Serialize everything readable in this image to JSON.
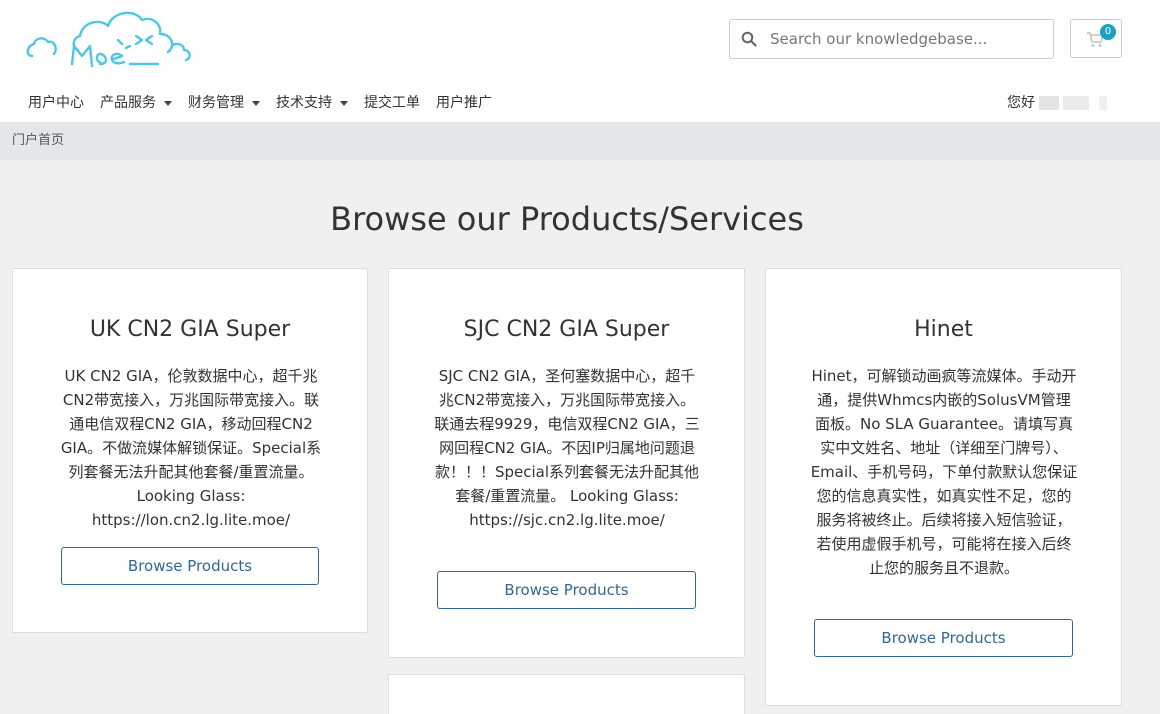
{
  "search": {
    "placeholder": "Search our knowledgebase..."
  },
  "cart": {
    "count": "0"
  },
  "nav": {
    "items": [
      {
        "label": "用户中心",
        "dropdown": false
      },
      {
        "label": "产品服务",
        "dropdown": true
      },
      {
        "label": "财务管理",
        "dropdown": true
      },
      {
        "label": "技术支持",
        "dropdown": true
      },
      {
        "label": "提交工单",
        "dropdown": false
      },
      {
        "label": "用户推广",
        "dropdown": false
      }
    ],
    "greeting": "您好"
  },
  "breadcrumb": {
    "home": "门户首页"
  },
  "main": {
    "title": "Browse our Products/Services",
    "cards": [
      {
        "title": "UK CN2 GIA Super",
        "description": "UK CN2 GIA，伦敦数据中心，超千兆CN2带宽接入，万兆国际带宽接入。联通电信双程CN2 GIA，移动回程CN2 GIA。不做流媒体解锁保证。Special系列套餐无法升配其他套餐/重置流量。 Looking Glass: https://lon.cn2.lg.lite.moe/",
        "button": "Browse Products"
      },
      {
        "title": "SJC CN2 GIA Super",
        "description": "SJC CN2 GIA，圣何塞数据中心，超千兆CN2带宽接入，万兆国际带宽接入。联通去程9929，电信双程CN2 GIA，三网回程CN2 GIA。不因IP归属地问题退款！！！Special系列套餐无法升配其他套餐/重置流量。 Looking Glass: https://sjc.cn2.lg.lite.moe/",
        "button": "Browse Products"
      },
      {
        "title": "Hinet",
        "description": "Hinet，可解锁动画疯等流媒体。手动开通，提供Whmcs内嵌的SolusVM管理面板。No SLA Guarantee。请填写真实中文姓名、地址（详细至门牌号）、Email、手机号码，下单付款默认您保证您的信息真实性，如真实性不足，您的服务将被终止。后续将接入短信验证，若使用虚假手机号，可能将在接入后终止您的服务且不退款。",
        "button": "Browse Products"
      }
    ]
  },
  "colors": {
    "accent": "#1ba1c4",
    "button": "#336699",
    "breadcrumb_bg": "#e4e7ea",
    "page_bg": "#f0f0f0"
  }
}
